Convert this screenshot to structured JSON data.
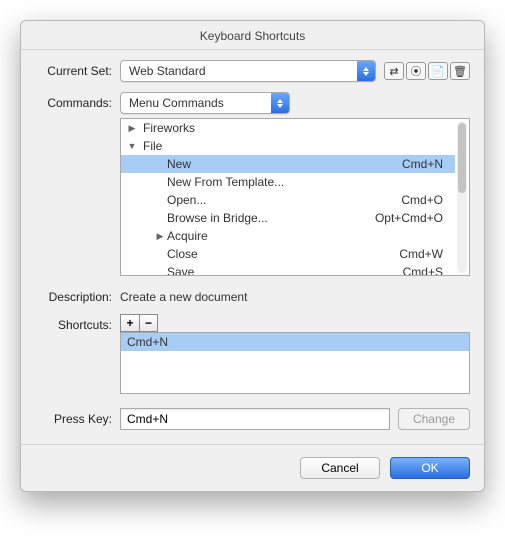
{
  "title": "Keyboard Shortcuts",
  "labels": {
    "current_set": "Current Set:",
    "commands": "Commands:",
    "description": "Description:",
    "shortcuts": "Shortcuts:",
    "press_key": "Press Key:"
  },
  "current_set": {
    "value": "Web Standard"
  },
  "commands_select": {
    "value": "Menu Commands"
  },
  "tree": [
    {
      "name": "Fireworks",
      "shortcut": "",
      "expanded": false,
      "level": 1,
      "hasChildren": true
    },
    {
      "name": "File",
      "shortcut": "",
      "expanded": true,
      "level": 1,
      "hasChildren": true
    },
    {
      "name": "New",
      "shortcut": "Cmd+N",
      "level": 2,
      "selected": true
    },
    {
      "name": "New From Template...",
      "shortcut": "",
      "level": 2
    },
    {
      "name": "Open...",
      "shortcut": "Cmd+O",
      "level": 2
    },
    {
      "name": "Browse in Bridge...",
      "shortcut": "Opt+Cmd+O",
      "level": 2
    },
    {
      "name": "Acquire",
      "shortcut": "",
      "level": 2,
      "hasChildren": true,
      "expanded": false
    },
    {
      "name": "Close",
      "shortcut": "Cmd+W",
      "level": 2
    },
    {
      "name": "Save",
      "shortcut": "Cmd+S",
      "level": 2
    }
  ],
  "description": "Create a new document",
  "plusminus": {
    "plus": "+",
    "minus": "−"
  },
  "shortcut_entry": "Cmd+N",
  "press_key_value": "Cmd+N",
  "buttons": {
    "change": "Change",
    "cancel": "Cancel",
    "ok": "OK"
  },
  "icons": {
    "rename": "⇄",
    "help": "⦿",
    "export": "📄",
    "trash": "🗑"
  }
}
